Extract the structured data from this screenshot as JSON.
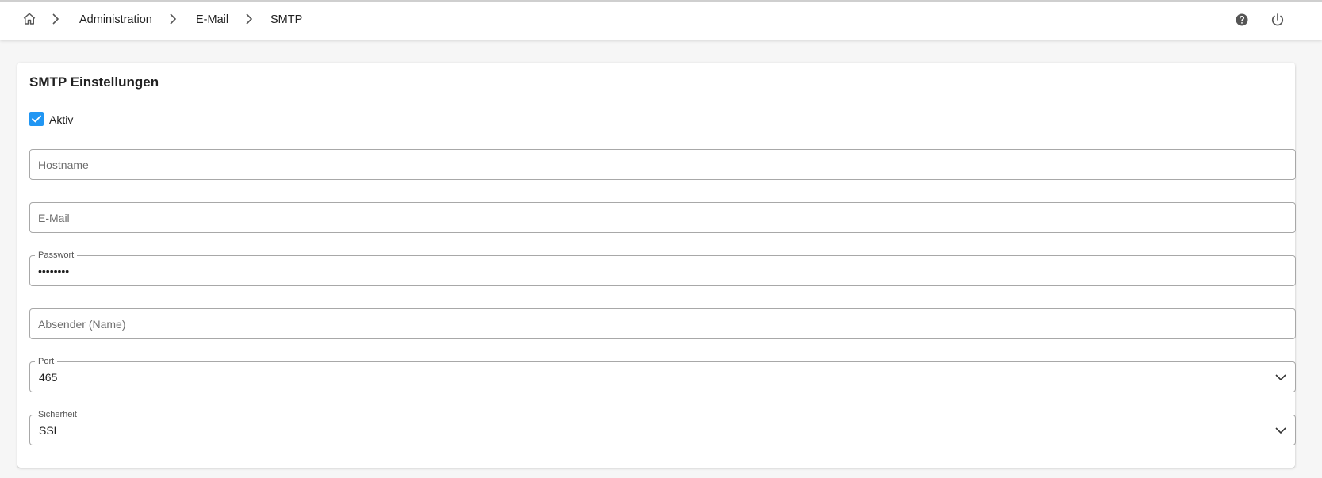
{
  "breadcrumb": {
    "home_icon": "home-icon",
    "items": [
      "Administration",
      "E-Mail",
      "SMTP"
    ]
  },
  "toolbar": {
    "help_icon": "help-icon",
    "power_icon": "power-icon"
  },
  "card": {
    "title": "SMTP Einstellungen",
    "active": {
      "label": "Aktiv",
      "checked": true
    },
    "fields": {
      "hostname": {
        "placeholder": "Hostname",
        "value": ""
      },
      "email": {
        "placeholder": "E-Mail",
        "value": ""
      },
      "password": {
        "label": "Passwort",
        "value": "password"
      },
      "sender": {
        "placeholder": "Absender (Name)",
        "value": ""
      },
      "port": {
        "label": "Port",
        "value": "465"
      },
      "security": {
        "label": "Sicherheit",
        "value": "SSL"
      }
    }
  },
  "colors": {
    "accent": "#2196f3",
    "background": "#f6f6f6",
    "border": "#a8a8a8"
  }
}
